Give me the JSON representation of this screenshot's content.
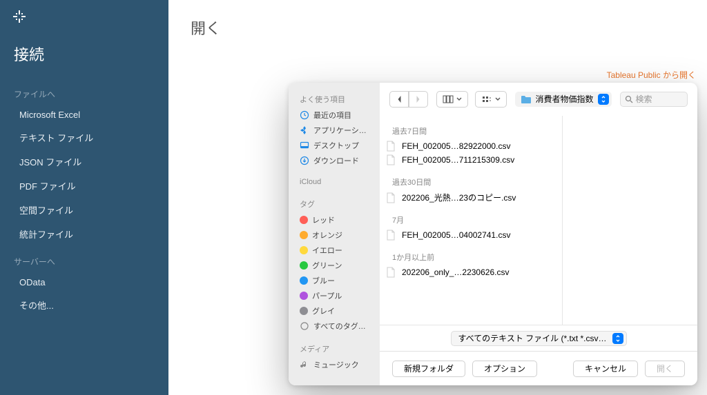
{
  "app": {
    "title": "接続",
    "sections": {
      "files_label": "ファイルへ",
      "servers_label": "サーバーへ",
      "files": [
        "Microsoft Excel",
        "テキスト ファイル",
        "JSON ファイル",
        "PDF ファイル",
        "空間ファイル",
        "統計ファイル"
      ],
      "servers": [
        "OData",
        "その他..."
      ]
    }
  },
  "main": {
    "title": "開く",
    "tableau_link": "Tableau Public から開く"
  },
  "dialog": {
    "sidebar": {
      "favorites_label": "よく使う項目",
      "favorites": [
        "最近の項目",
        "アプリケーシ…",
        "デスクトップ",
        "ダウンロード"
      ],
      "icloud_label": "iCloud",
      "tags_label": "タグ",
      "tags": [
        "レッド",
        "オレンジ",
        "イエロー",
        "グリーン",
        "ブルー",
        "パープル",
        "グレイ",
        "すべてのタグ…"
      ],
      "media_label": "メディア",
      "media": [
        "ミュージック"
      ]
    },
    "location": "消費者物価指数",
    "search_placeholder": "検索",
    "groups": [
      {
        "label": "過去7日間",
        "files": [
          "FEH_002005…82922000.csv",
          "FEH_002005…711215309.csv"
        ]
      },
      {
        "label": "過去30日間",
        "files": [
          "202206_光熱…23のコピー.csv"
        ]
      },
      {
        "label": "7月",
        "files": [
          "FEH_002005…04002741.csv"
        ]
      },
      {
        "label": "1か月以上前",
        "files": [
          "202206_only_…2230626.csv"
        ]
      }
    ],
    "filter": "すべてのテキスト ファイル (*.txt *.csv…",
    "footer": {
      "new_folder": "新規フォルダ",
      "options": "オプション",
      "cancel": "キャンセル",
      "open": "開く"
    }
  }
}
